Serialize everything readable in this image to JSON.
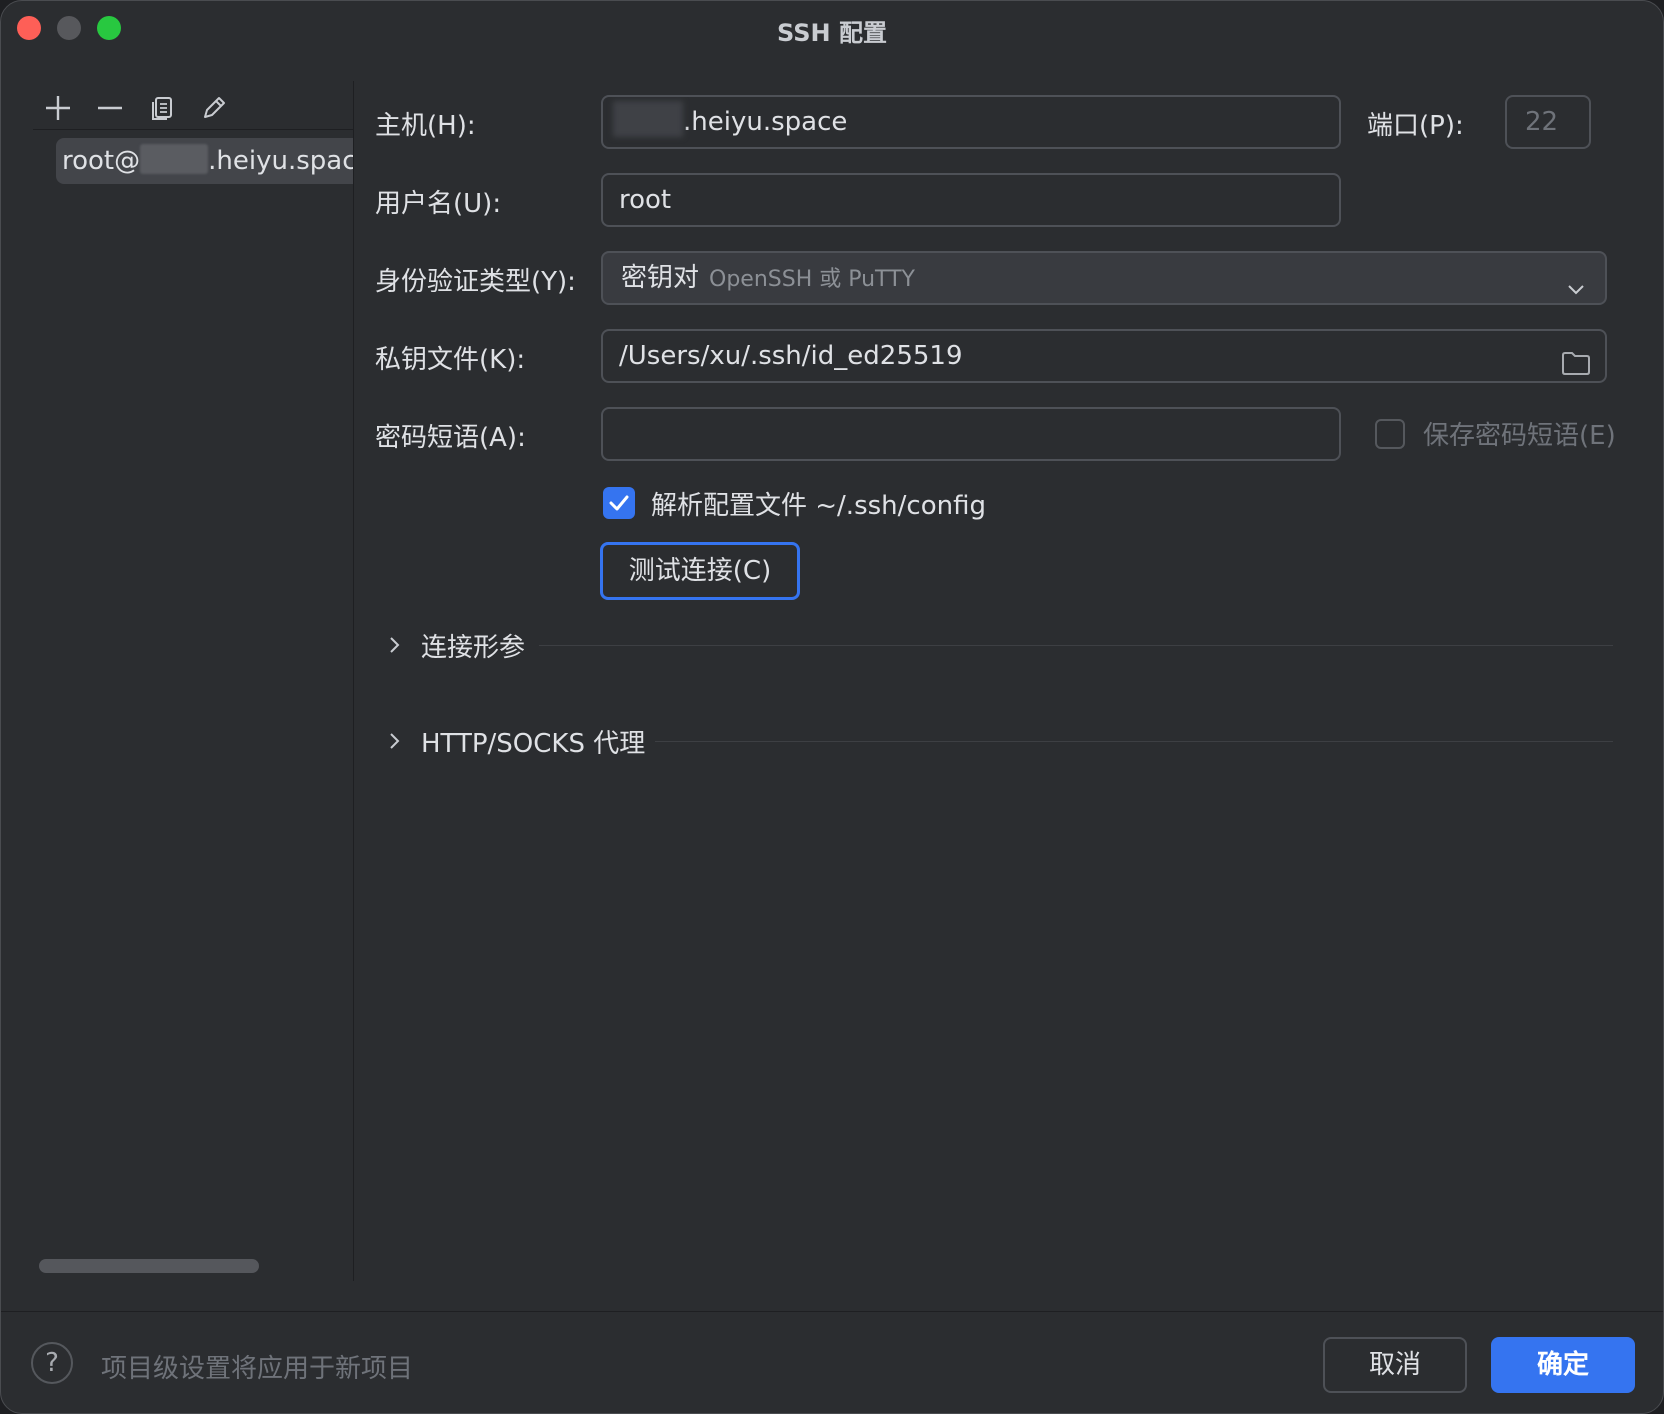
{
  "window": {
    "title": "SSH 配置"
  },
  "sidebar": {
    "toolbar": {
      "add_icon": "plus-icon",
      "remove_icon": "minus-icon",
      "copy_icon": "copy-icon",
      "edit_icon": "pencil-icon"
    },
    "items": [
      {
        "prefix": "root@",
        "suffix": ".heiyu.space"
      }
    ]
  },
  "form": {
    "host": {
      "label": "主机(H):",
      "value": ".heiyu.space"
    },
    "port": {
      "label": "端口(P):",
      "value": "22"
    },
    "username": {
      "label": "用户名(U):",
      "value": "root"
    },
    "auth_type": {
      "label": "身份验证类型(Y):",
      "value": "密钥对",
      "hint": "OpenSSH 或 PuTTY"
    },
    "key_file": {
      "label": "私钥文件(K):",
      "value": "/Users/xu/.ssh/id_ed25519"
    },
    "passphrase": {
      "label": "密码短语(A):",
      "value": ""
    },
    "save_passphrase": {
      "label": "保存密码短语(E)",
      "checked": false
    },
    "parse_config": {
      "label": "解析配置文件 ~/.ssh/config",
      "checked": true
    },
    "test_button": "测试连接(C)"
  },
  "sections": [
    {
      "title": "连接形参"
    },
    {
      "title": "HTTP/SOCKS 代理"
    }
  ],
  "footer": {
    "help": "?",
    "text": "项目级设置将应用于新项目",
    "cancel": "取消",
    "ok": "确定"
  },
  "colors": {
    "accent": "#3574f0",
    "background": "#2b2d30"
  }
}
